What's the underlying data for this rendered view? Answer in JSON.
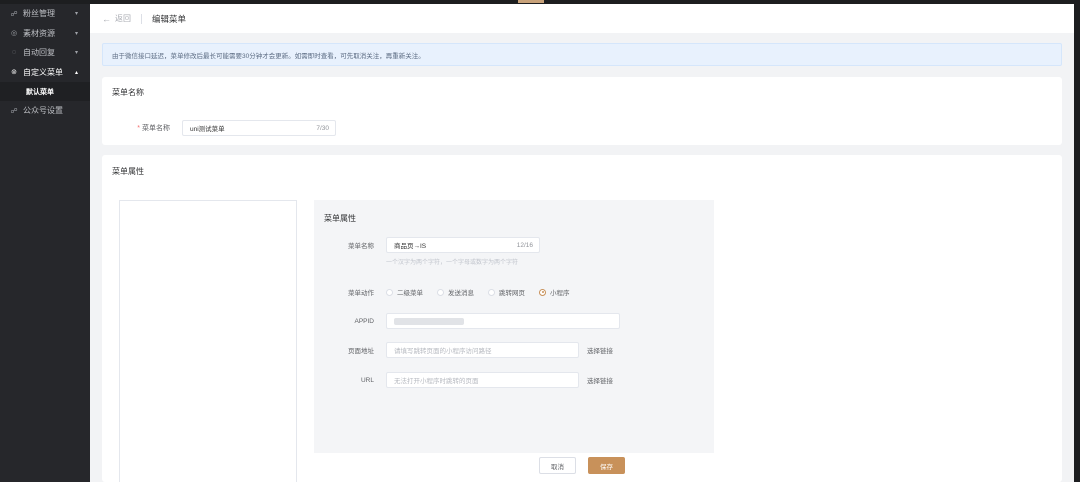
{
  "sidebar": {
    "items": [
      {
        "label": "粉丝管理",
        "icon": "users-icon",
        "caret": "▾"
      },
      {
        "label": "素材资源",
        "icon": "image-icon",
        "caret": "▾"
      },
      {
        "label": "自动回复",
        "icon": "chat-icon",
        "caret": "▾"
      },
      {
        "label": "自定义菜单",
        "icon": "menu-icon",
        "caret": "▴"
      },
      {
        "label": "公众号设置",
        "icon": "settings-icon"
      }
    ],
    "subitem": "默认菜单"
  },
  "topbar": {
    "back_label": "返回",
    "title": "编辑菜单"
  },
  "alert": {
    "text": "由于微信接口延迟，菜单修改后最长可能需要30分钟才会更新。如需即时查看，可先取消关注，再重新关注。"
  },
  "menu_name_section": {
    "title": "菜单名称",
    "label": "菜单名称",
    "value": "uni测试菜单",
    "count": "7/30"
  },
  "menu_props_section": {
    "title": "菜单属性",
    "panel_title": "菜单属性",
    "name_label": "菜单名称",
    "name_value": "商品页→IS",
    "name_count": "12/16",
    "name_help": "一个汉字为两个字符，一个字母或数字为两个字符",
    "action_label": "菜单动作",
    "action_options": [
      "二级菜单",
      "发送消息",
      "跳转网页",
      "小程序"
    ],
    "action_selected": "小程序",
    "appid_label": "APPID",
    "page_label": "页面地址",
    "page_placeholder": "请填写跳转页面的小程序访问路径",
    "page_link": "选择链接",
    "url_label": "URL",
    "url_placeholder": "无法打开小程序时跳转的页面",
    "url_link": "选择链接"
  },
  "buttons": {
    "cancel": "取消",
    "save": "保存"
  },
  "colors": {
    "accent": "#c8915a",
    "sidebar_bg": "#26272b",
    "alert_bg": "#e8f1fd"
  }
}
